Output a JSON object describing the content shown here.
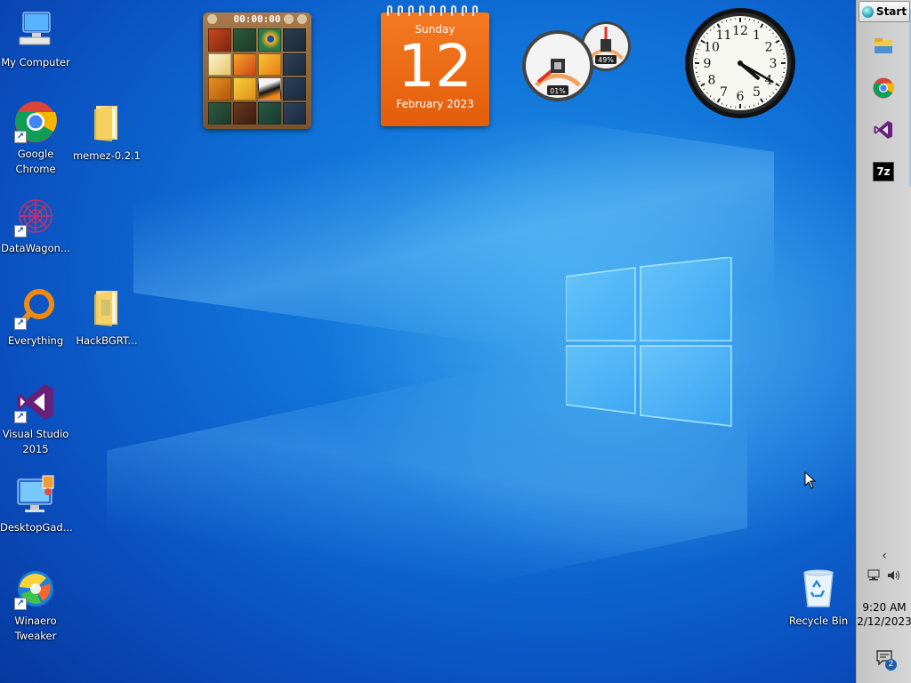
{
  "desktop": {
    "icons": [
      {
        "label": "My Computer",
        "icon": "computer-icon"
      },
      {
        "label": "Google Chrome",
        "icon": "chrome-icon"
      },
      {
        "label": "memez-0.2.1",
        "icon": "folder-icon"
      },
      {
        "label": "DataWagon...",
        "icon": "datawagon-icon"
      },
      {
        "label": "Everything",
        "icon": "everything-search-icon"
      },
      {
        "label": "HackBGRT...",
        "icon": "folder-icon"
      },
      {
        "label": "Visual Studio 2015",
        "icon": "visual-studio-icon"
      },
      {
        "label": "DesktopGad...",
        "icon": "desktop-gadgets-icon"
      },
      {
        "label": "Winaero Tweaker",
        "icon": "winaero-tweaker-icon"
      },
      {
        "label": "Recycle Bin",
        "icon": "recycle-bin-icon"
      }
    ]
  },
  "gadgets": {
    "puzzle": {
      "timer": "00:00:00"
    },
    "calendar": {
      "weekday": "Sunday",
      "day": "12",
      "month_year": "February 2023"
    },
    "meters": {
      "cpu": "01%",
      "memory": "49%"
    },
    "clock": {
      "hours": 4,
      "minutes": 20,
      "numerals": [
        "12",
        "1",
        "2",
        "3",
        "4",
        "5",
        "6",
        "7",
        "8",
        "9",
        "10",
        "11"
      ]
    }
  },
  "sidebar": {
    "start_label": "Start",
    "pinned": [
      "file-explorer-icon",
      "chrome-icon",
      "visual-studio-icon",
      "7zip-icon"
    ],
    "pinned_7zip_text": "7z",
    "time": "9:20 AM",
    "date": "2/12/2023",
    "notification_count": "2"
  }
}
